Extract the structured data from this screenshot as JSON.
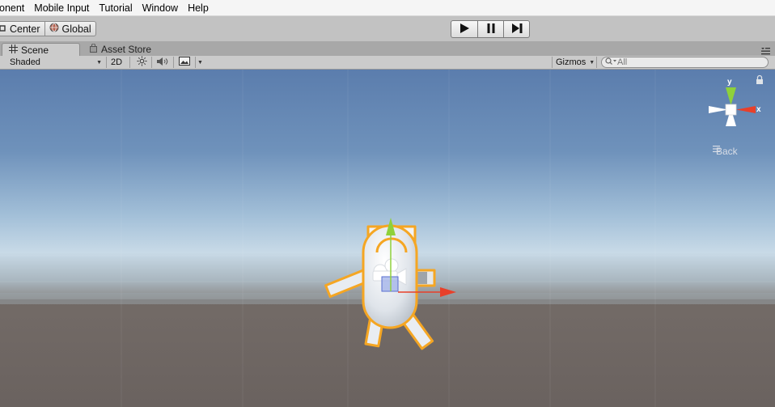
{
  "menu": {
    "items": [
      {
        "label": "onent"
      },
      {
        "label": "Mobile Input"
      },
      {
        "label": "Tutorial"
      },
      {
        "label": "Window"
      },
      {
        "label": "Help"
      }
    ]
  },
  "toolbar": {
    "pivot_label": "Center",
    "rotation_label": "Global",
    "play_icon": "play-icon",
    "pause_icon": "pause-icon",
    "step_icon": "step-icon"
  },
  "tabs": {
    "scene_label": "Scene",
    "asset_store_label": "Asset Store"
  },
  "scene_toolbar": {
    "draw_mode": "Shaded",
    "mode_2d": "2D",
    "gizmos_label": "Gizmos",
    "search_placeholder": "All"
  },
  "orientation_gizmo": {
    "y_label": "y",
    "x_label": "x",
    "view_label": "Back",
    "colors": {
      "x": "#e8402a",
      "y": "#8fd13a",
      "z": "#ffffff"
    }
  },
  "colors": {
    "selection_outline": "#f5a623",
    "sky_top": "#5d7fae",
    "sky_horizon": "#c7d8e6",
    "ground": "#6d6561"
  }
}
